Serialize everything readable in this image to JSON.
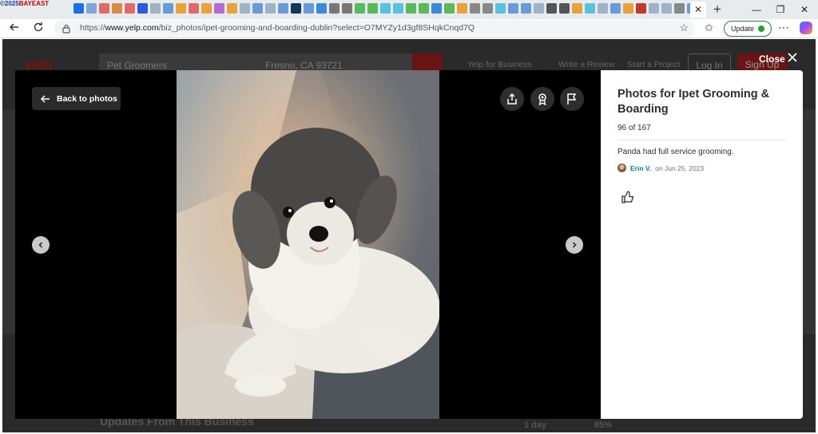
{
  "browser": {
    "watermark_prefix": "©2025",
    "watermark_brand": "BAYEAST",
    "url_scheme": "https://",
    "url_domain": "www.yelp.com",
    "url_path": "/biz_photos/ipet-grooming-and-boarding-dublin?select=O7MYZy1d3gf8SHqkCnqd7Q",
    "update_label": "Update",
    "tab_close": "✕",
    "new_tab": "+",
    "minimize": "—",
    "restore": "❐",
    "close_window": "✕"
  },
  "background_page": {
    "logo": "yelp",
    "search_term": "Pet Groomers",
    "location": "Fresno, CA 93721",
    "nav_business": "Yelp for Business",
    "nav_review": "Write a Review",
    "nav_project": "Start a Project",
    "login": "Log In",
    "signup": "Sign Up",
    "updates_heading": "Updates From This Business",
    "stat_time": "1 day",
    "stat_rate": "85%"
  },
  "modal": {
    "close_label": "Close",
    "back_label": "Back to photos",
    "title": "Photos for Ipet Grooming & Boarding",
    "count": "96 of 167",
    "caption": "Panda had full service grooming.",
    "author": "Erin V.",
    "date_text": "on Jun 25, 2023"
  },
  "icons": [
    "back-arrow-icon",
    "share-icon",
    "award-icon",
    "flag-icon",
    "chevron-left-icon",
    "chevron-right-icon",
    "thumbs-up-icon",
    "close-icon",
    "lock-icon",
    "star-icon"
  ]
}
